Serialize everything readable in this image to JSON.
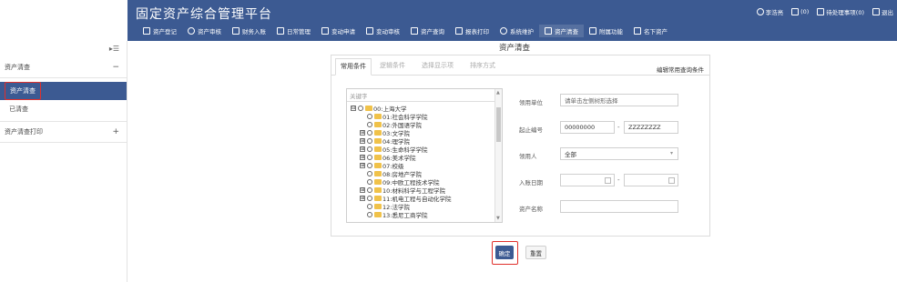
{
  "header": {
    "title": "固定资产综合管理平台",
    "top_right": [
      {
        "icon": "user-icon",
        "label": "李浩亮"
      },
      {
        "icon": "mail-icon",
        "label": "(0)"
      },
      {
        "icon": "todo-icon",
        "label": "待处理事项(0)"
      },
      {
        "icon": "logout-icon",
        "label": "退出"
      }
    ],
    "nav": [
      {
        "icon": "register-icon",
        "label": "资产登记"
      },
      {
        "icon": "audit-icon",
        "label": "资产审核"
      },
      {
        "icon": "finance-icon",
        "label": "财务入账"
      },
      {
        "icon": "grid-icon",
        "label": "日常管理"
      },
      {
        "icon": "apply-icon",
        "label": "变动申请"
      },
      {
        "icon": "change-audit-icon",
        "label": "变动审核"
      },
      {
        "icon": "query-icon",
        "label": "资产查询"
      },
      {
        "icon": "print-icon",
        "label": "报表打印"
      },
      {
        "icon": "settings-icon",
        "label": "系统维护"
      },
      {
        "icon": "home-icon",
        "label": "资产清查"
      },
      {
        "icon": "extra-icon",
        "label": "附属功能"
      },
      {
        "icon": "bar-chart-icon",
        "label": "名下资产"
      }
    ]
  },
  "sidebar": {
    "collapse_icon": "collapse-icon",
    "groups": [
      {
        "label": "资产清查",
        "sign": "−"
      },
      {
        "label": "资产清查",
        "active": true
      },
      {
        "label": "已清查"
      },
      {
        "label": "资产清查打印",
        "sign": "+"
      }
    ]
  },
  "main": {
    "title": "资产清查",
    "tabs": [
      "常用条件",
      "逻辑条件",
      "选择显示项",
      "排序方式"
    ],
    "edit_link": "编辑常用查询条件",
    "tree": {
      "search_placeholder": "关键字",
      "nodes": [
        {
          "label": "00:上海大学",
          "expand": "⊟",
          "level": 0
        },
        {
          "label": "01:社会科学学院",
          "expand": "",
          "level": 1
        },
        {
          "label": "02:外国语学院",
          "expand": "",
          "level": 1
        },
        {
          "label": "03:文学院",
          "expand": "⊞",
          "level": 1
        },
        {
          "label": "04:理学院",
          "expand": "⊞",
          "level": 1
        },
        {
          "label": "05:生命科学学院",
          "expand": "⊞",
          "level": 1
        },
        {
          "label": "06:美术学院",
          "expand": "⊞",
          "level": 1
        },
        {
          "label": "07:校级",
          "expand": "⊞",
          "level": 1
        },
        {
          "label": "08:房地产学院",
          "expand": "",
          "level": 1
        },
        {
          "label": "09:中欧工程技术学院",
          "expand": "",
          "level": 1
        },
        {
          "label": "10:材料科学与工程学院",
          "expand": "⊞",
          "level": 1
        },
        {
          "label": "11:机电工程与自动化学院",
          "expand": "⊞",
          "level": 1
        },
        {
          "label": "12:法学院",
          "expand": "",
          "level": 1
        },
        {
          "label": "13:悉尼工商学院",
          "expand": "",
          "level": 1
        }
      ]
    },
    "form": {
      "dept_label": "领用单位",
      "dept_placeholder": "请单击左侧树形选择",
      "code_label": "起止编号",
      "code_from": "00000000",
      "code_sep": "-",
      "code_to": "ZZZZZZZZ",
      "user_label": "领用人",
      "user_value": "全部",
      "date_label": "入账日期",
      "date_sep": "-",
      "name_label": "资产名称"
    },
    "buttons": {
      "confirm": "确定",
      "reset": "重置"
    }
  },
  "colors": {
    "brand": "#3c5a92",
    "highlight": "#e0302b"
  }
}
